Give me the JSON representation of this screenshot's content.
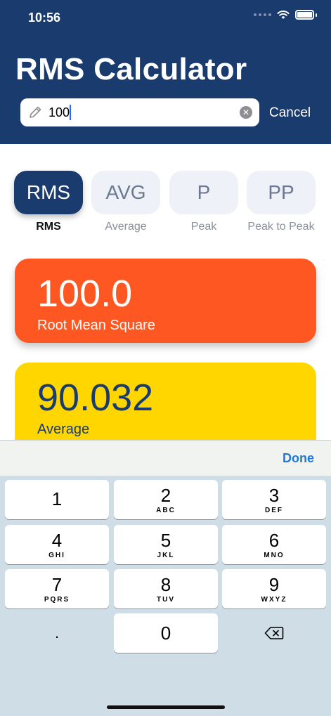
{
  "status_bar": {
    "time": "10:56"
  },
  "header": {
    "title": "RMS Calculator",
    "search_value": "100",
    "cancel_label": "Cancel"
  },
  "tabs": [
    {
      "short": "RMS",
      "label": "RMS",
      "active": true
    },
    {
      "short": "AVG",
      "label": "Average",
      "active": false
    },
    {
      "short": "P",
      "label": "Peak",
      "active": false
    },
    {
      "short": "PP",
      "label": "Peak to Peak",
      "active": false
    }
  ],
  "results": [
    {
      "value": "100.0",
      "caption": "Root Mean Square",
      "color": "#ff5722"
    },
    {
      "value": "90.032",
      "caption": "Average",
      "color": "#ffd600"
    }
  ],
  "keyboard": {
    "done_label": "Done",
    "keys": [
      {
        "num": "1",
        "letters": ""
      },
      {
        "num": "2",
        "letters": "ABC"
      },
      {
        "num": "3",
        "letters": "DEF"
      },
      {
        "num": "4",
        "letters": "GHI"
      },
      {
        "num": "5",
        "letters": "JKL"
      },
      {
        "num": "6",
        "letters": "MNO"
      },
      {
        "num": "7",
        "letters": "PQRS"
      },
      {
        "num": "8",
        "letters": "TUV"
      },
      {
        "num": "9",
        "letters": "WXYZ"
      },
      {
        "num": "0",
        "letters": ""
      }
    ],
    "decimal": "."
  },
  "colors": {
    "header": "#1a3b6e",
    "accent_blue": "#1e7ad6"
  }
}
